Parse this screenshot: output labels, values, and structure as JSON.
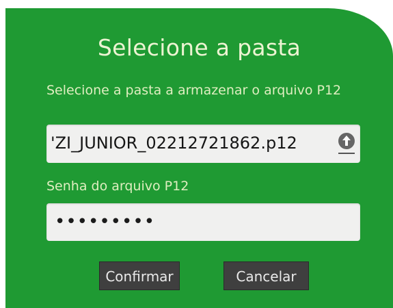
{
  "dialog": {
    "title": "Selecione a pasta",
    "file_label": "Selecione a pasta a armazenar o arquivo P12",
    "file_value": "'ZI_JUNIOR_02212721862.p12",
    "file_icon": "upload-icon",
    "password_label": "Senha do arquivo P12",
    "password_value": "•••••••••",
    "confirm_label": "Confirmar",
    "cancel_label": "Cancelar"
  },
  "colors": {
    "panel": "#1f9a33",
    "button": "#3f3f3f",
    "field": "#f0f0ef"
  }
}
